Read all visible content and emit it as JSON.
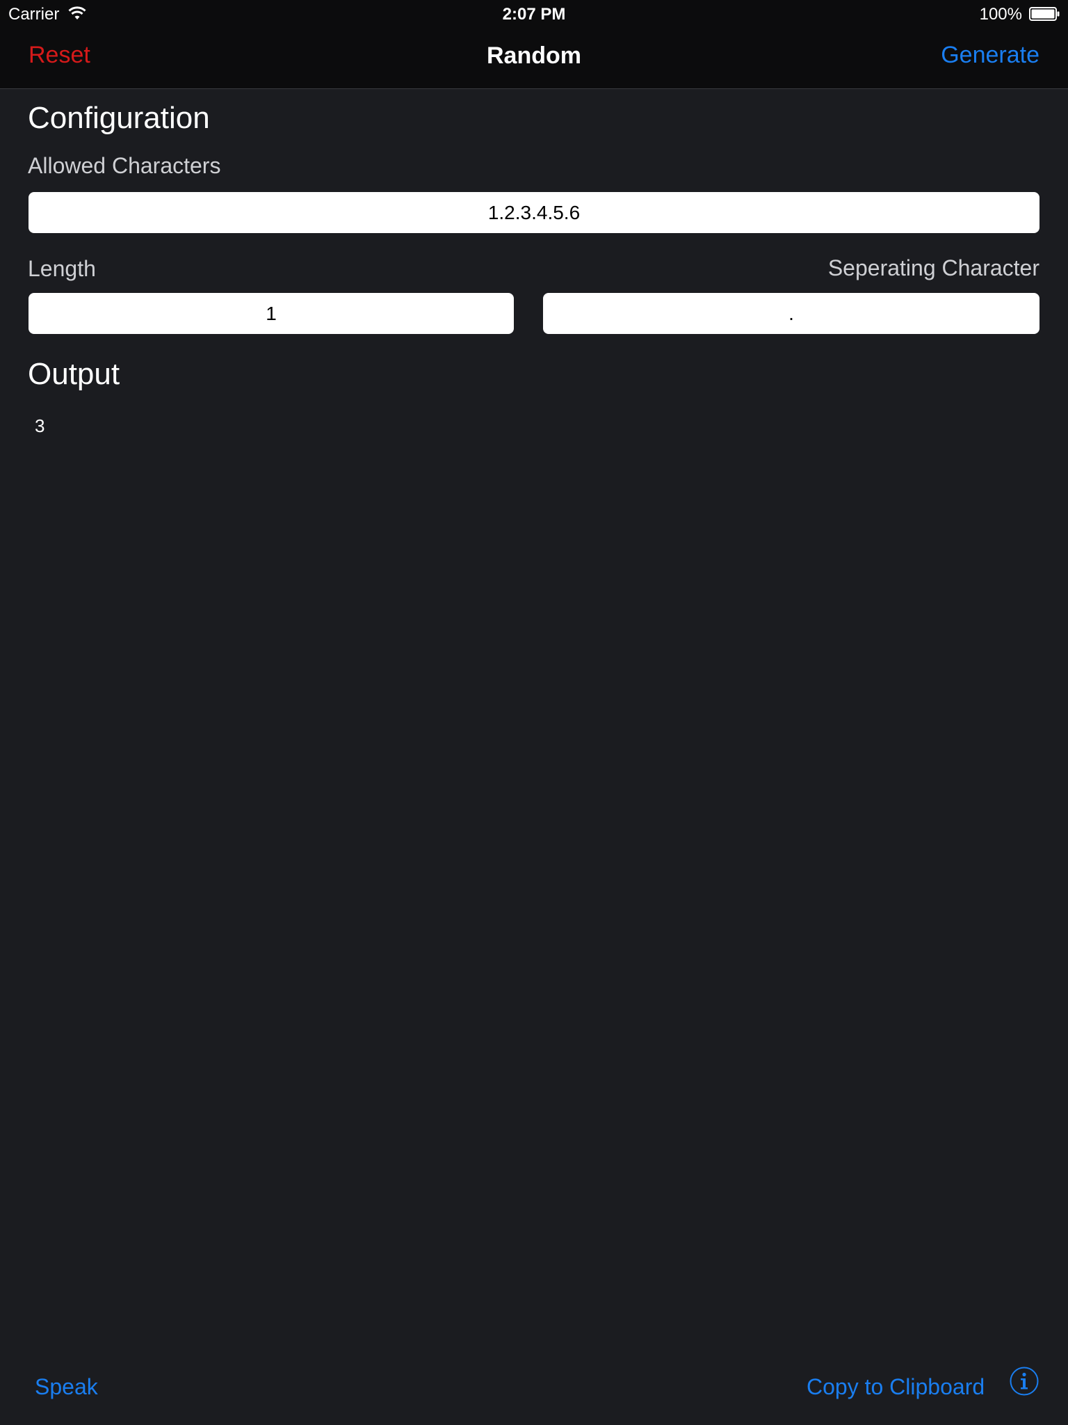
{
  "status_bar": {
    "carrier": "Carrier",
    "time": "2:07 PM",
    "battery_percent": "100%",
    "icons": [
      "wifi-icon",
      "battery-icon"
    ]
  },
  "nav_bar": {
    "reset_label": "Reset",
    "title": "Random",
    "generate_label": "Generate"
  },
  "configuration": {
    "heading": "Configuration",
    "allowed_characters_label": "Allowed Characters",
    "allowed_characters_value": "1.2.3.4.5.6",
    "length_label": "Length",
    "length_value": "1",
    "separator_label": "Seperating Character",
    "separator_value": "."
  },
  "output": {
    "heading": "Output",
    "value": "3"
  },
  "toolbar": {
    "speak_label": "Speak",
    "copy_label": "Copy to Clipboard",
    "info_icon": "info-icon"
  },
  "colors": {
    "background": "#1b1c20",
    "bar_background": "#0c0c0d",
    "reset": "#d51a1a",
    "accent": "#1a7ef0"
  }
}
